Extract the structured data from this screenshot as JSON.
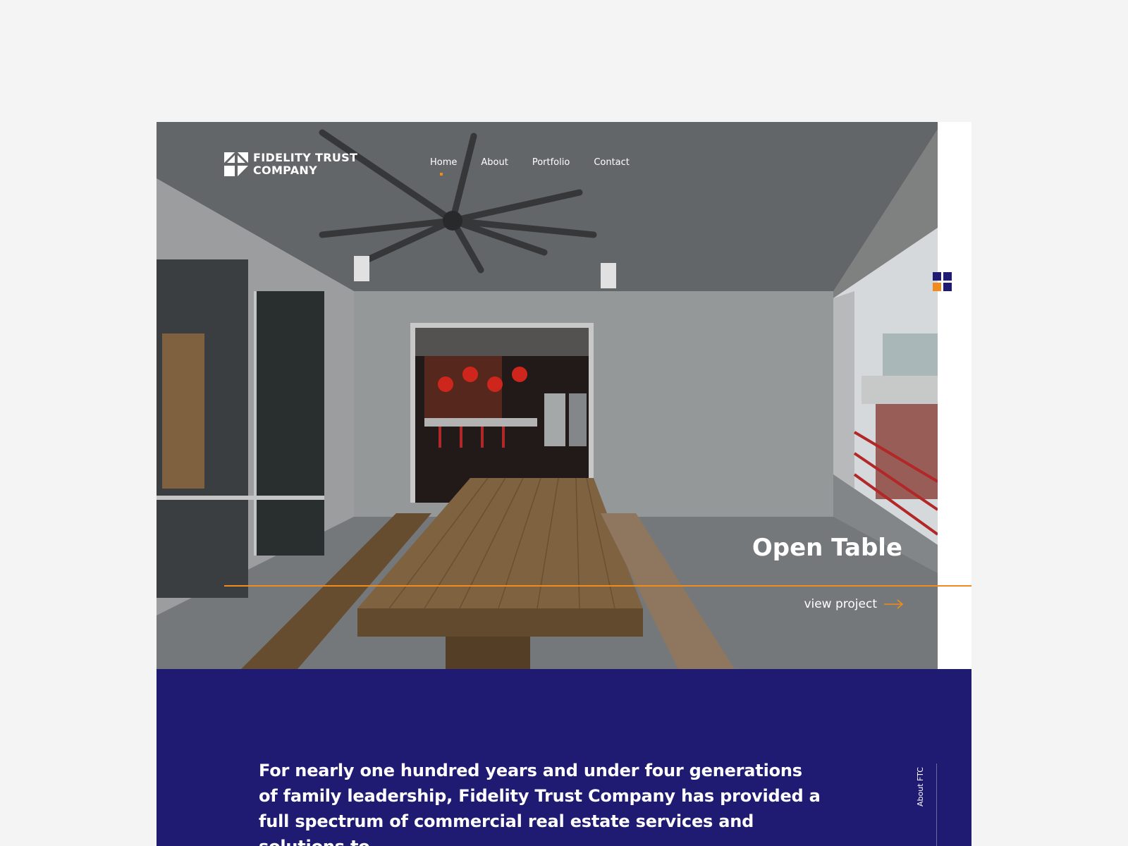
{
  "brand": {
    "name_line1": "FIDELITY TRUST",
    "name_line2": "COMPANY"
  },
  "nav": {
    "items": [
      {
        "label": "Home",
        "active": true
      },
      {
        "label": "About",
        "active": false
      },
      {
        "label": "Portfolio",
        "active": false
      },
      {
        "label": "Contact",
        "active": false
      }
    ]
  },
  "hero": {
    "title": "Open Table",
    "cta_label": "view project",
    "cta_icon": "arrow-right-icon",
    "photo": "covered patio with long wooden table and benches, ceiling fan, open doorway to kitchen, red railing"
  },
  "side_icon": {
    "name": "grid-icon",
    "colors": [
      "#1f1a72",
      "#1f1a72",
      "#f08b1d",
      "#1f1a72"
    ]
  },
  "about": {
    "text": "For nearly one hundred years and under four generations of family leadership, Fidelity Trust Company has provided a full spectrum of commercial real estate services and solutions to",
    "side_label": "About FTC"
  },
  "colors": {
    "navy": "#1f1a72",
    "accent_orange": "#f08b1d",
    "page_bg": "#f4f4f4",
    "white": "#ffffff"
  }
}
